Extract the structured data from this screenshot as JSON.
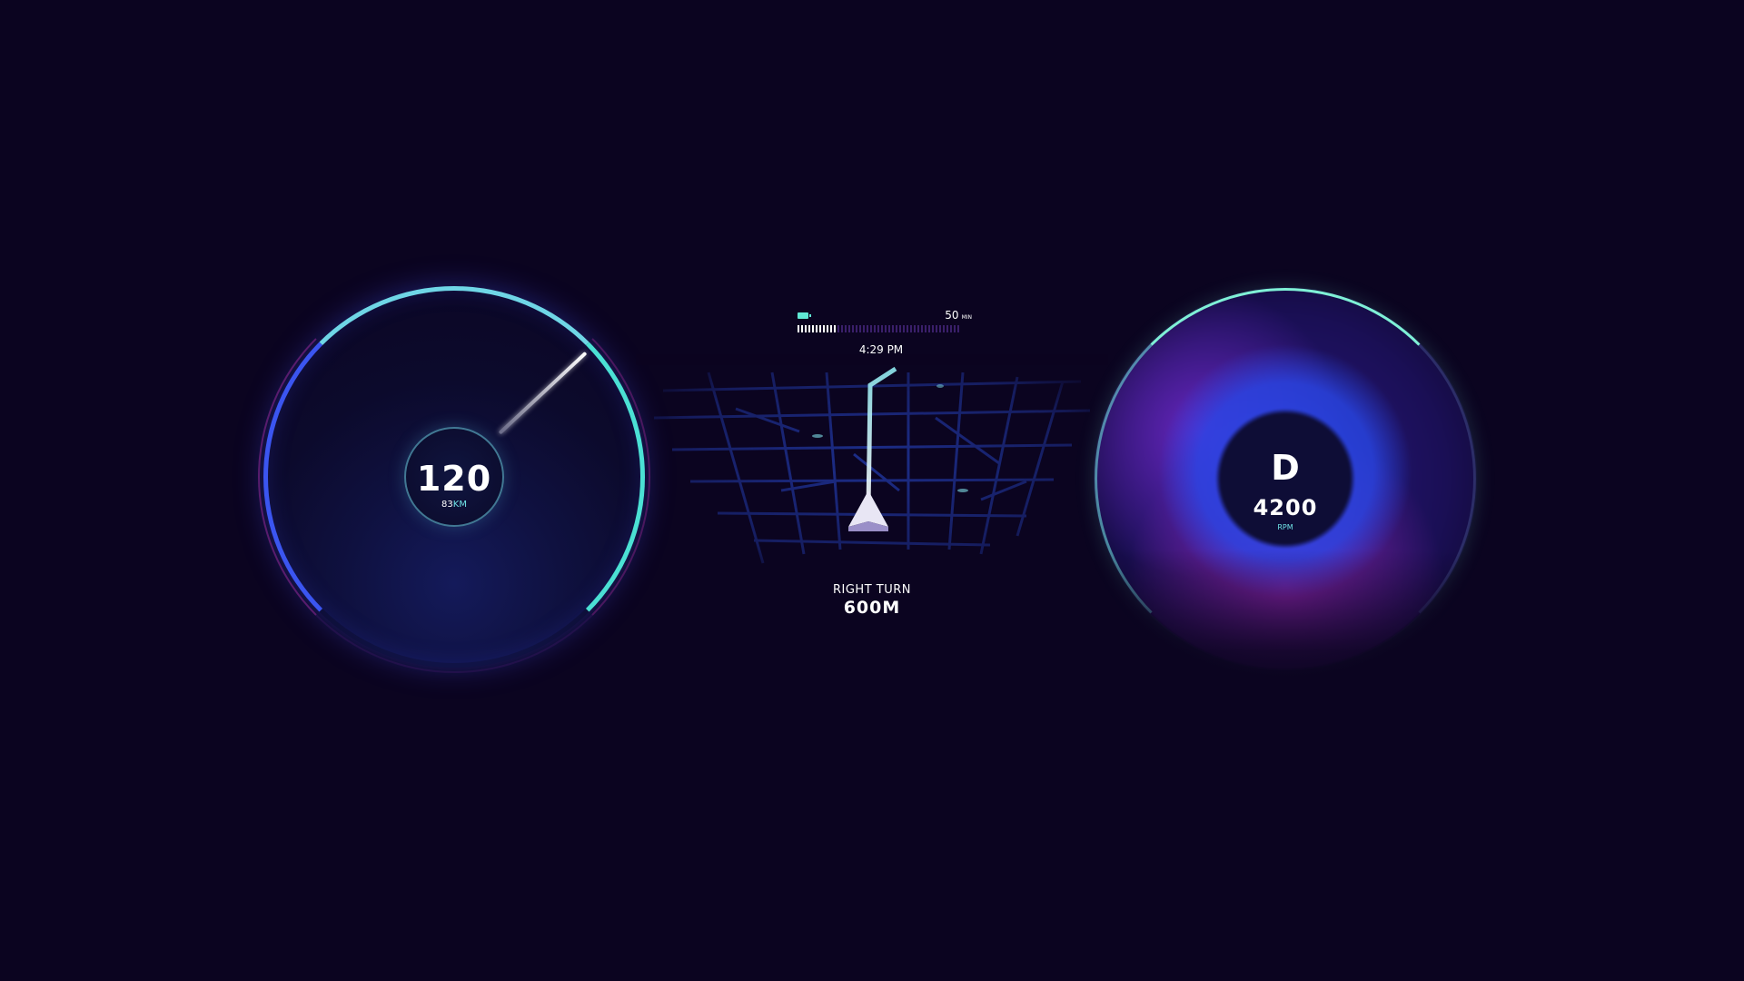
{
  "speedometer": {
    "speed": "120",
    "range_value": "83",
    "range_unit": "KM"
  },
  "navigation": {
    "battery_icon": "battery-icon",
    "time_remaining_value": "50",
    "time_remaining_unit": "MIN",
    "trip_progress_fraction": 0.25,
    "clock": "4:29 PM",
    "instruction": "RIGHT TURN",
    "distance": "600M"
  },
  "tachometer": {
    "gear": "D",
    "rpm": "4200",
    "rpm_unit": "RPM"
  },
  "colors": {
    "background": "#0b0420",
    "accent_cyan": "#6fe3e6",
    "accent_blue": "#3b55f0",
    "accent_magenta": "#b02ab8",
    "map_roads": "#1d2e8a"
  }
}
